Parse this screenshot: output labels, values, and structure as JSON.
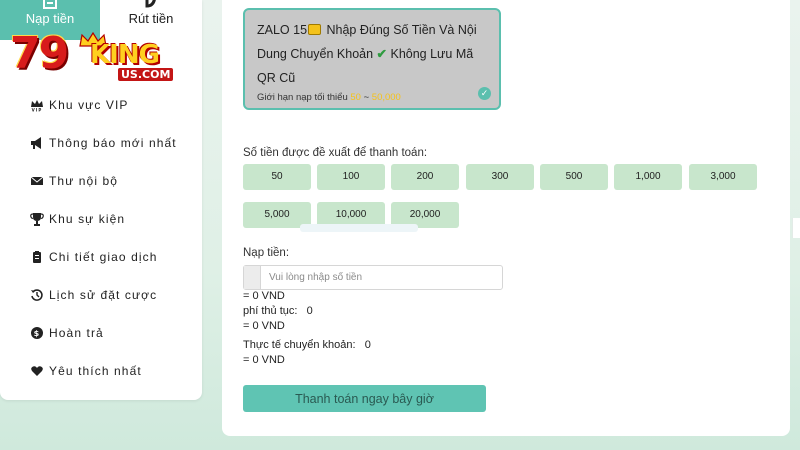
{
  "sidebar": {
    "tabs": [
      {
        "label": "Nạp tiền",
        "icon": "deposit-icon",
        "active": true
      },
      {
        "label": "Rút tiền",
        "icon": "withdraw-icon",
        "active": false
      }
    ],
    "logo": {
      "number": "79",
      "brand": "KING",
      "domain": "US.COM"
    },
    "menu": [
      {
        "label": "Khu vực VIP",
        "icon": "vip-crown-icon"
      },
      {
        "label": "Thông báo mới nhất",
        "icon": "megaphone-icon"
      },
      {
        "label": "Thư nội bộ",
        "icon": "envelope-icon"
      },
      {
        "label": "Khu sự kiện",
        "icon": "trophy-icon"
      },
      {
        "label": "Chi tiết giao dịch",
        "icon": "clipboard-icon"
      },
      {
        "label": "Lịch sử đặt cược",
        "icon": "history-icon"
      },
      {
        "label": "Hoàn trả",
        "icon": "dollar-circle-icon"
      },
      {
        "label": "Yêu thích nhất",
        "icon": "heart-icon"
      }
    ]
  },
  "method": {
    "title_line1_a": "ZALO 15",
    "title_line1_b": " Nhập Đúng Số Tiền Và Nội",
    "title_line2_a": "Dung Chuyển Khoản ",
    "title_line2_b": " Không Lưu Mã",
    "title_line3": "QR Cũ",
    "limit_label": "Giới hạn nạp tối thiểu ",
    "limit_min": "50",
    "limit_sep": " ~ ",
    "limit_max": "50,000"
  },
  "suggest_label": "Số tiền được đề xuất để thanh toán:",
  "amounts": [
    "50",
    "100",
    "200",
    "300",
    "500",
    "1,000",
    "3,000",
    "5,000",
    "10,000",
    "20,000"
  ],
  "deposit": {
    "label": "Nạp tiền:",
    "placeholder": "Vui lòng nhập số tiền",
    "equals_vnd": "= 0 VND",
    "fee_label": "phí thủ tục:",
    "fee_value": "0",
    "fee_vnd": "= 0 VND",
    "actual_label": "Thực tế chuyển khoản:",
    "actual_value": "0",
    "actual_vnd": "= 0 VND"
  },
  "pay_button": "Thanh toán ngay bây giờ",
  "colors": {
    "accent": "#5bbfae",
    "amount_button": "#c8e6cc",
    "card_bg": "#c8c8c8",
    "limit_highlight": "#f4c21b"
  }
}
